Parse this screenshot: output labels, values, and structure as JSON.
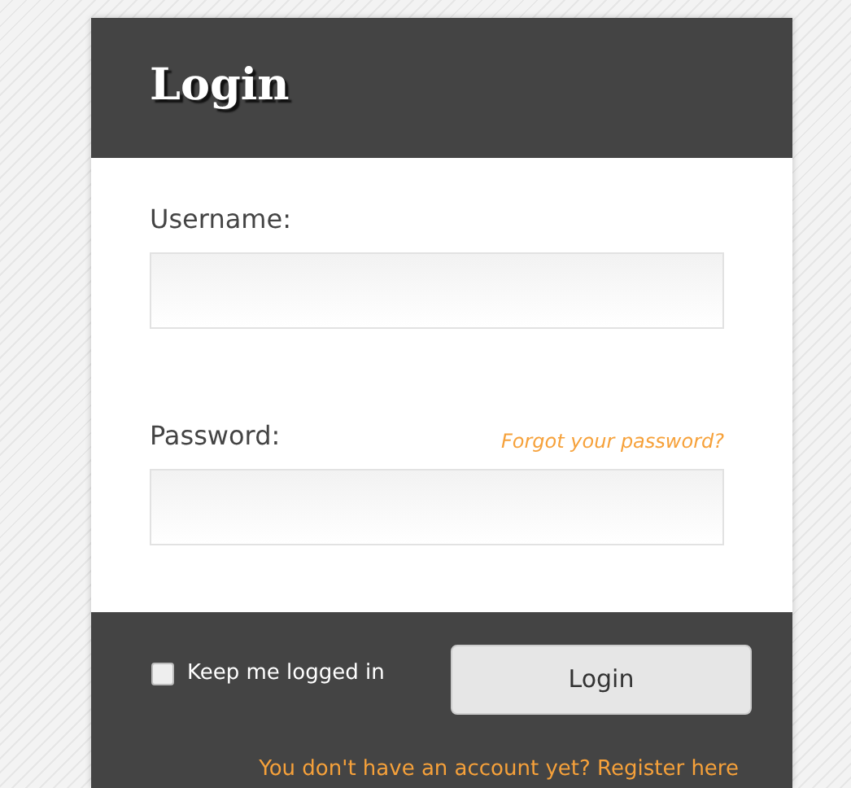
{
  "header": {
    "title": "Login"
  },
  "fields": [
    {
      "label": "Username:"
    },
    {
      "label": "Password:",
      "link": "Forgot your password?"
    }
  ],
  "remember": {
    "label": "Keep me logged in",
    "checked": false
  },
  "submit": "Login",
  "register": "You don't have an account yet? Register here"
}
